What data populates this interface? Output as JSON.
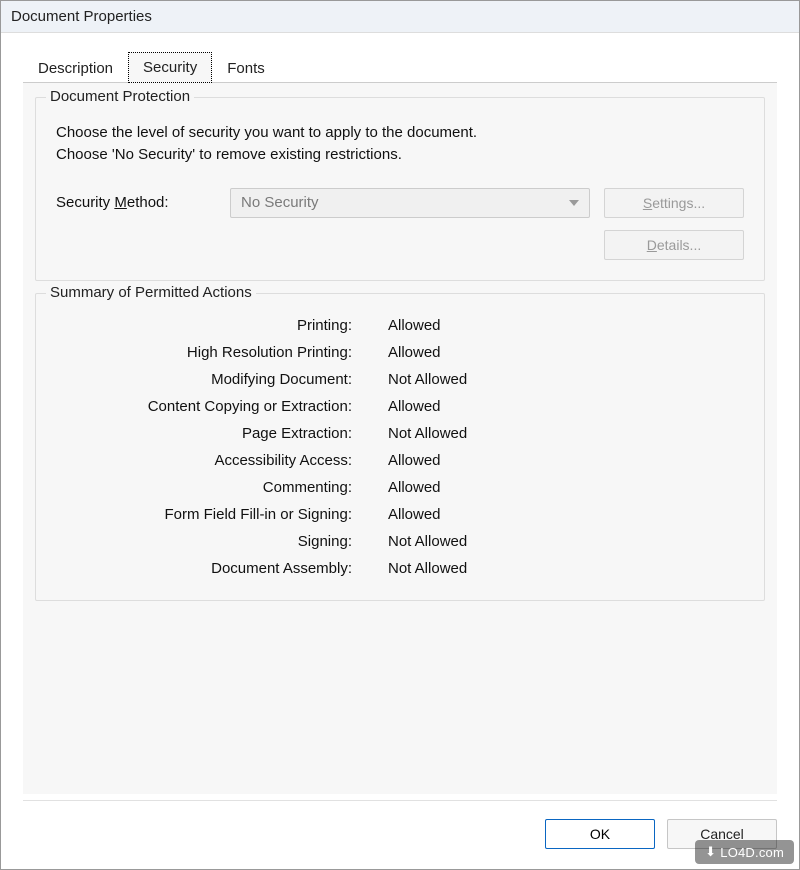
{
  "window": {
    "title": "Document Properties"
  },
  "tabs": {
    "description": "Description",
    "security": "Security",
    "fonts": "Fonts"
  },
  "protection": {
    "legend": "Document Protection",
    "help1": "Choose the level of security you want to apply to the document.",
    "help2": "Choose 'No Security' to remove existing restrictions.",
    "method_label_pre": "Security ",
    "method_label_hot": "M",
    "method_label_post": "ethod:",
    "selected": "No Security",
    "settings_hot": "S",
    "settings_rest": "ettings...",
    "details_hot": "D",
    "details_rest": "etails..."
  },
  "summary": {
    "legend": "Summary of Permitted Actions",
    "rows": [
      {
        "label": "Printing:",
        "value": "Allowed"
      },
      {
        "label": "High Resolution Printing:",
        "value": "Allowed"
      },
      {
        "label": "Modifying Document:",
        "value": "Not Allowed"
      },
      {
        "label": "Content Copying or Extraction:",
        "value": "Allowed"
      },
      {
        "label": "Page Extraction:",
        "value": "Not Allowed"
      },
      {
        "label": "Accessibility Access:",
        "value": "Allowed"
      },
      {
        "label": "Commenting:",
        "value": "Allowed"
      },
      {
        "label": "Form Field Fill-in or Signing:",
        "value": "Allowed"
      },
      {
        "label": "Signing:",
        "value": "Not Allowed"
      },
      {
        "label": "Document Assembly:",
        "value": "Not Allowed"
      }
    ]
  },
  "buttons": {
    "ok": "OK",
    "cancel": "Cancel"
  },
  "watermark": {
    "text": "LO4D.com"
  }
}
